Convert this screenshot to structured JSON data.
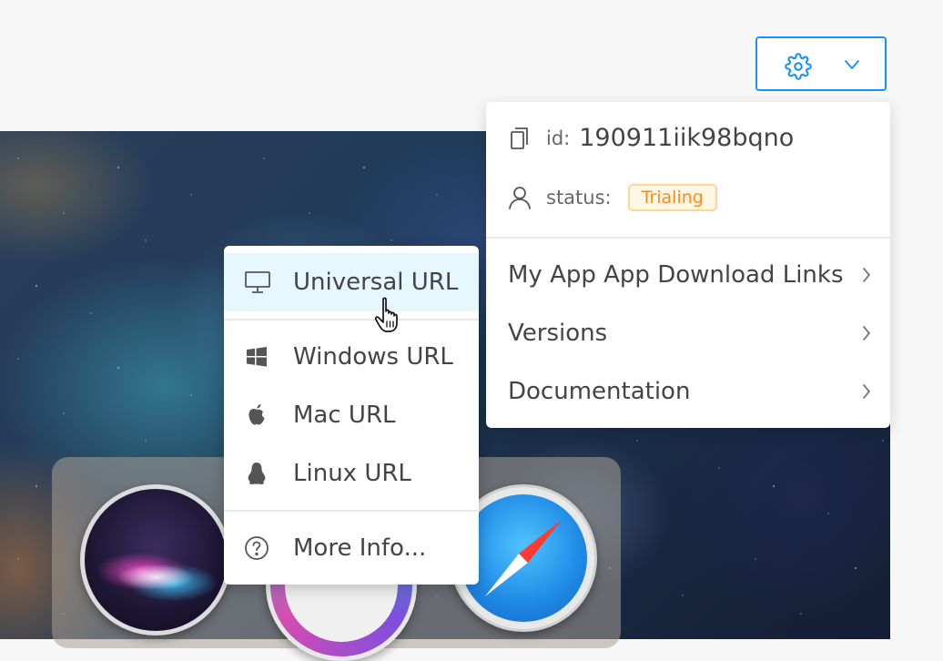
{
  "header": {
    "settings_icon": "gear-icon",
    "dropdown_icon": "chevron-down-icon"
  },
  "account": {
    "id_label": "id:",
    "id_value": "190911iik98bqno",
    "status_label": "status:",
    "status_value": "Trialing",
    "status_color": "#fa8c16"
  },
  "menu": {
    "items": [
      {
        "label": "My App App Download Links"
      },
      {
        "label": "Versions"
      },
      {
        "label": "Documentation"
      }
    ]
  },
  "download_menu": {
    "items": [
      {
        "label": "Universal URL",
        "icon": "monitor-icon"
      },
      {
        "label": "Windows URL",
        "icon": "windows-icon"
      },
      {
        "label": "Mac URL",
        "icon": "apple-icon"
      },
      {
        "label": "Linux URL",
        "icon": "linux-penguin-icon"
      },
      {
        "label": "More Info...",
        "icon": "question-circle-icon"
      }
    ]
  },
  "colors": {
    "accent": "#1890ff",
    "active_item_bg": "#e6f7ff"
  }
}
